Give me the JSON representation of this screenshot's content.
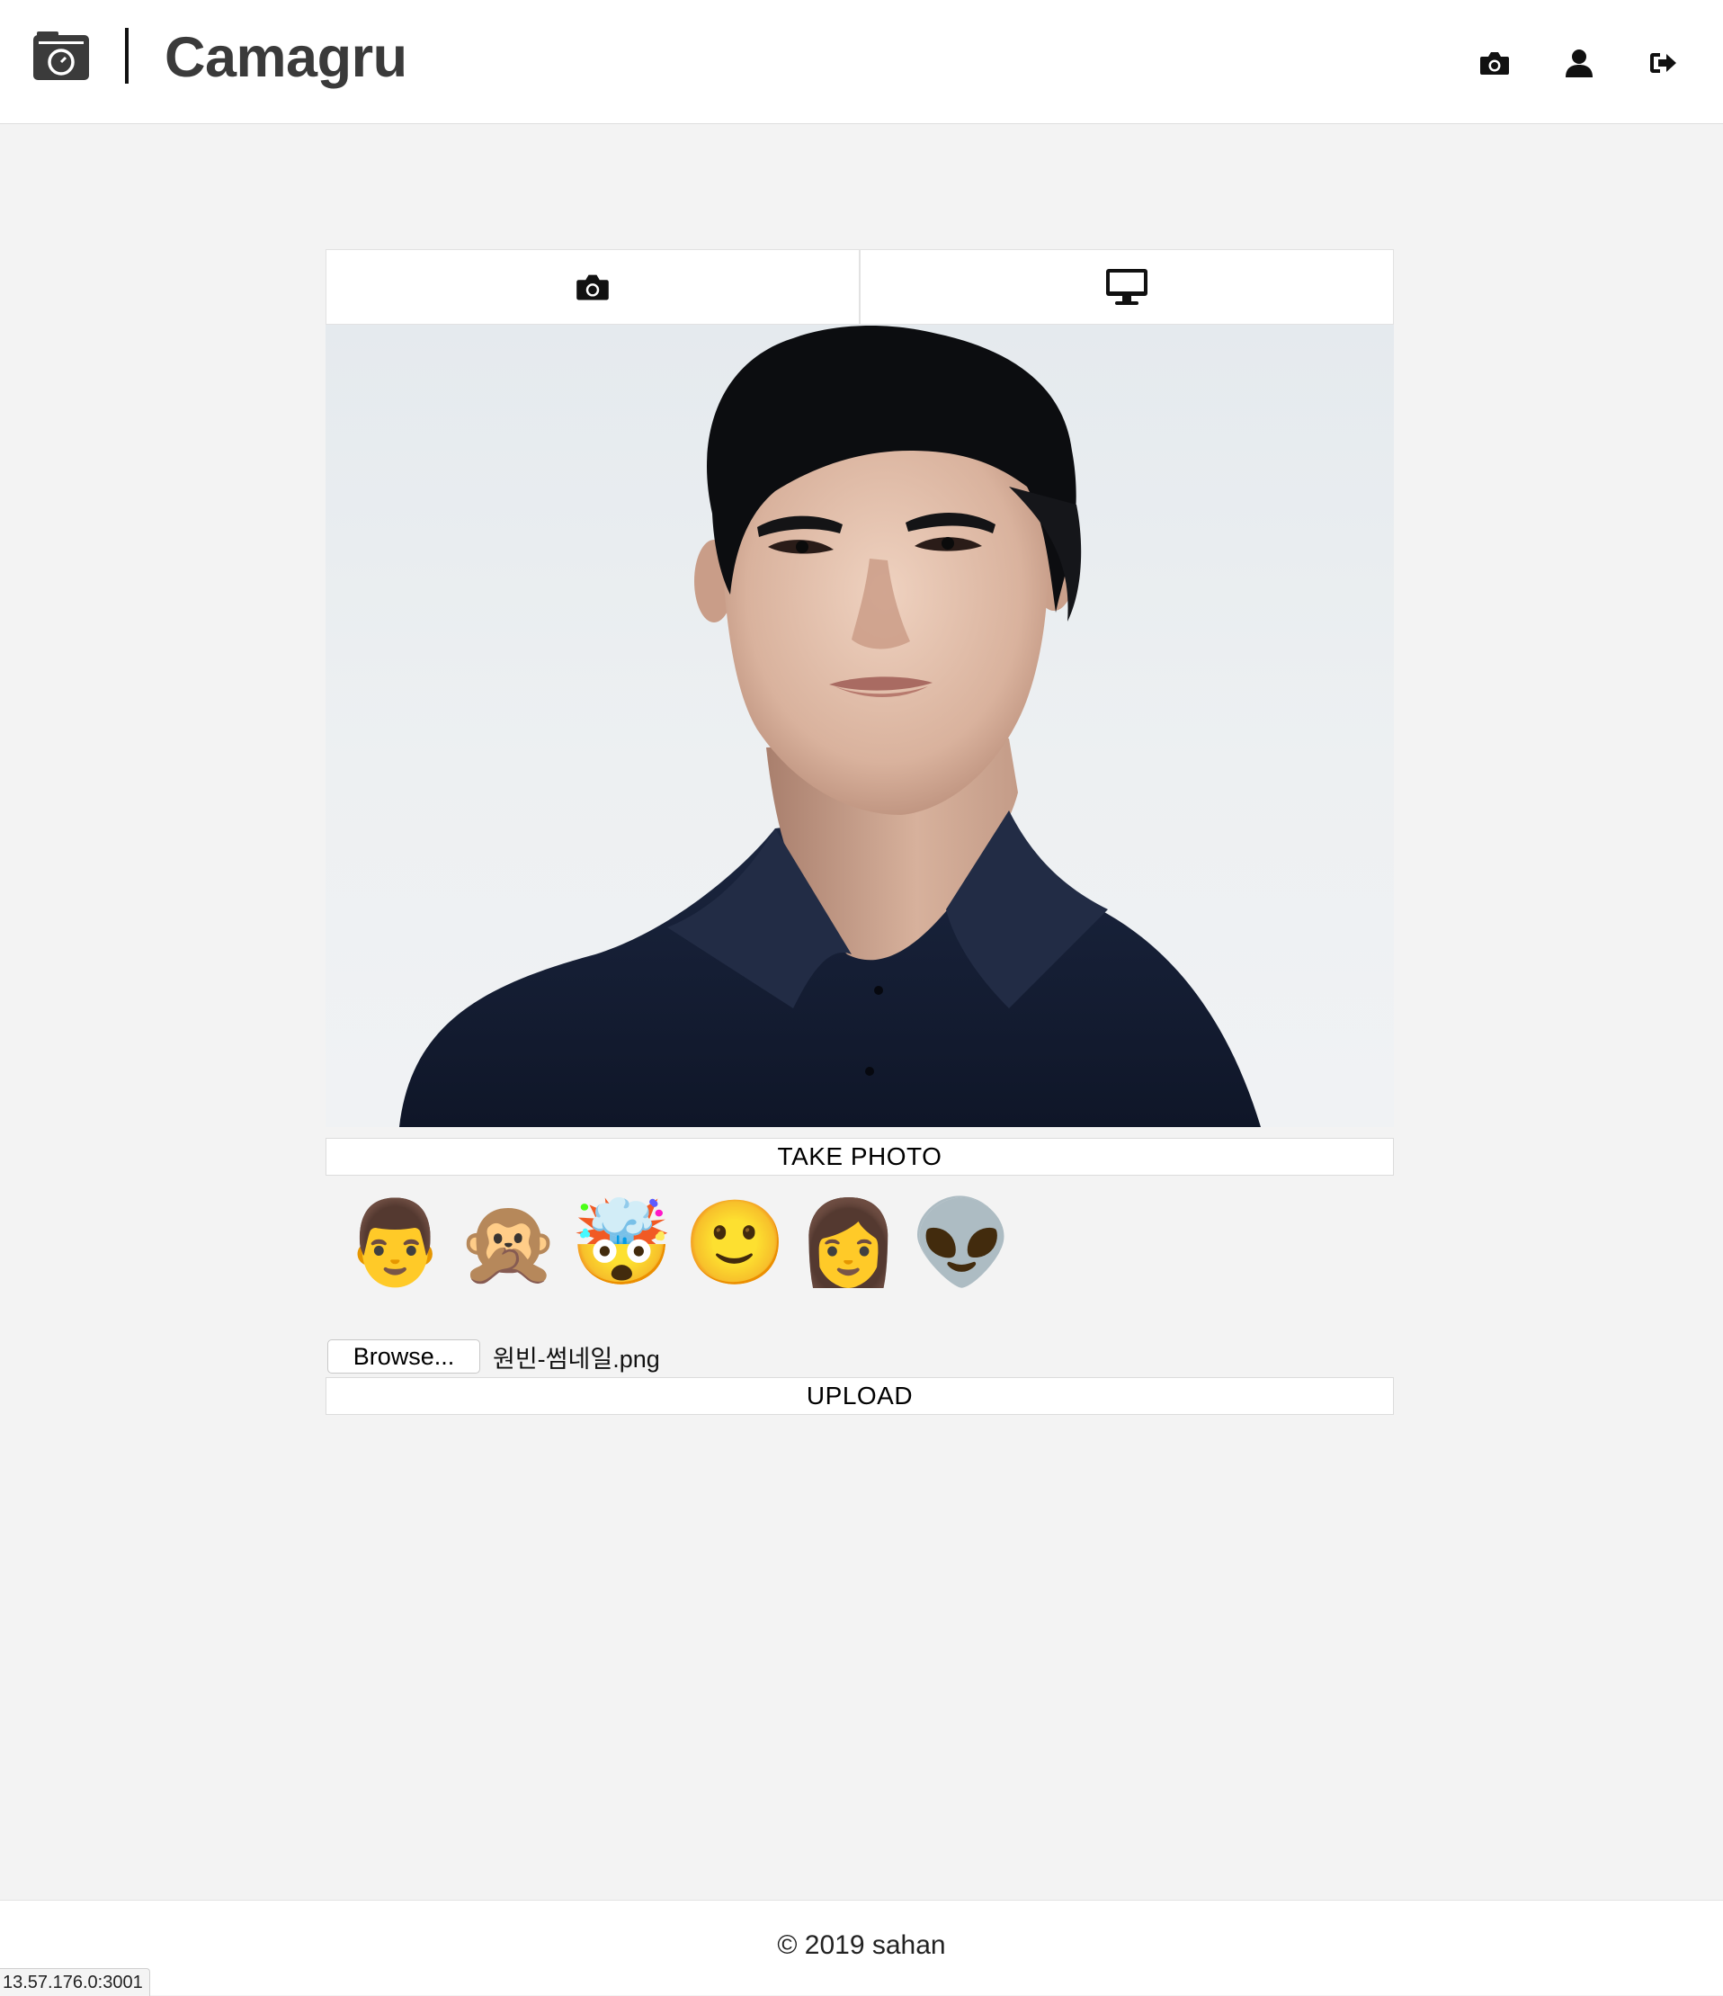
{
  "app": {
    "brand": "Camagru"
  },
  "header": {
    "logo_icon": "camera-box-icon",
    "nav": [
      {
        "name": "camera",
        "icon": "camera-icon"
      },
      {
        "name": "profile",
        "icon": "user-icon"
      },
      {
        "name": "logout",
        "icon": "sign-out-icon"
      }
    ]
  },
  "tabs": [
    {
      "name": "webcam",
      "icon": "camera-icon"
    },
    {
      "name": "screen",
      "icon": "desktop-icon"
    }
  ],
  "editor": {
    "take_photo_label": "TAKE PHOTO",
    "stickers": [
      "👨",
      "🙊",
      "🤯",
      "🙂",
      "👩",
      "👽"
    ],
    "browse_label": "Browse...",
    "file_name": "원빈-썸네일.png",
    "upload_label": "UPLOAD"
  },
  "footer": {
    "copyright": "© 2019 sahan"
  },
  "status_bar": {
    "url": "13.57.176.0:3001"
  },
  "colors": {
    "page_background": "#f3f3f3",
    "brand_text": "#3a3a3a",
    "icon": "#111111",
    "shirt": "#16203a",
    "hair": "#0c0d10"
  }
}
